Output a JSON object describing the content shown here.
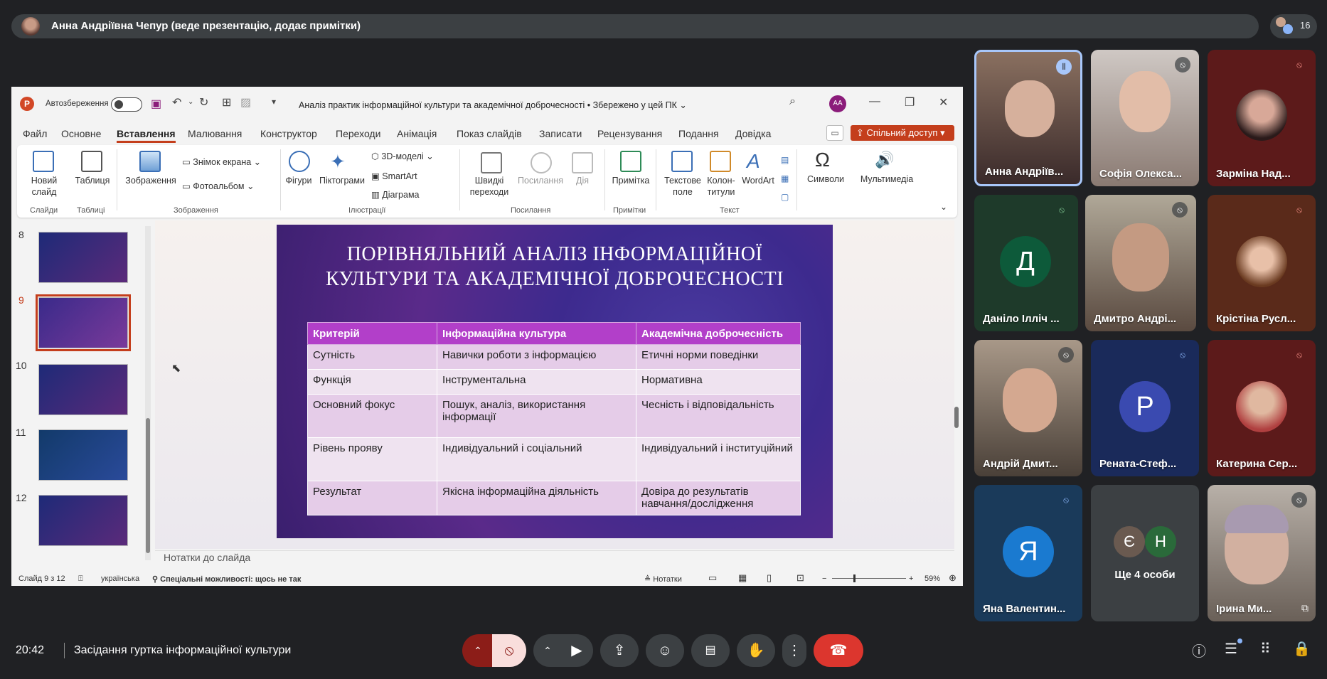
{
  "presenter_bar": {
    "text": "Анна Андріївна Чепур (веде презентацію, додає примітки)",
    "participant_count": "16"
  },
  "ppt": {
    "autosave": "Автозбереження",
    "doc_title": "Аналіз практик інформаційної культури та академічної доброчесності • Збережено у цей ПК",
    "user_initials": "AA",
    "tabs": [
      "Файл",
      "Основне",
      "Вставлення",
      "Малювання",
      "Конструктор",
      "Переходи",
      "Анімація",
      "Показ слайдів",
      "Записати",
      "Рецензування",
      "Подання",
      "Довідка"
    ],
    "share": "Спільний доступ",
    "ribbon": {
      "new_slide": "Новий\nслайд",
      "table": "Таблиця",
      "images": "Зображення",
      "screenshot": "Знімок екрана",
      "photo_album": "Фотоальбом",
      "shapes": "Фігури",
      "icons": "Піктограми",
      "models3d": "3D-моделі",
      "smartart": "SmartArt",
      "chart": "Діаграма",
      "quick_links": "Швидкі\nпереходи",
      "link": "Посилання",
      "action": "Дія",
      "comment": "Примітка",
      "textbox": "Текстове\nполе",
      "header_footer": "Колон-\nтитули",
      "wordart": "WordArt",
      "symbols": "Символи",
      "media": "Мультимедіа",
      "groups": {
        "slides": "Слайди",
        "tables": "Таблиці",
        "images": "Зображення",
        "illustrations": "Ілюстрації",
        "links": "Посилання",
        "comments": "Примітки",
        "text": "Текст"
      }
    },
    "thumb_numbers": [
      "8",
      "9",
      "10",
      "11",
      "12"
    ],
    "slide": {
      "title": "ПОРІВНЯЛЬНИЙ АНАЛІЗ ІНФОРМАЦІЙНОЇ КУЛЬТУРИ ТА АКАДЕМІЧНОЇ ДОБРОЧЕСНОСТІ",
      "headers": [
        "Критерій",
        "Інформаційна культура",
        "Академічна доброчесність"
      ],
      "rows": [
        [
          "Сутність",
          "Навички роботи з інформацією",
          "Етичні норми поведінки"
        ],
        [
          "Функція",
          "Інструментальна",
          "Нормативна"
        ],
        [
          "Основний фокус",
          "Пошук, аналіз, використання інформації",
          "Чесність і відповідальність"
        ],
        [
          "Рівень прояву",
          "Індивідуальний і соціальний",
          "Індивідуальний і інституційний"
        ],
        [
          "Результат",
          "Якісна інформаційна діяльність",
          "Довіра до результатів навчання/дослідження"
        ]
      ]
    },
    "notes_placeholder": "Нотатки до слайда",
    "status": {
      "slide": "Слайд 9 з 12",
      "lang": "українська",
      "accessibility": "Спеціальні можливості: щось не так",
      "notes": "Нотатки",
      "zoom": "59%"
    }
  },
  "tiles": [
    {
      "name": "Анна Андріїв...",
      "initial": ""
    },
    {
      "name": "Софія Олекса...",
      "initial": ""
    },
    {
      "name": "Зарміна Над...",
      "initial": ""
    },
    {
      "name": "Даніло Ілліч ...",
      "initial": "Д"
    },
    {
      "name": "Дмитро Андрі...",
      "initial": ""
    },
    {
      "name": "Крістіна Русл...",
      "initial": ""
    },
    {
      "name": "Андрій Дмит...",
      "initial": ""
    },
    {
      "name": "Рената-Стеф...",
      "initial": "Р"
    },
    {
      "name": "Катерина Сер...",
      "initial": ""
    },
    {
      "name": "Яна Валентин...",
      "initial": "Я"
    },
    {
      "name": "Ще 4 особи",
      "initial1": "Є",
      "initial2": "Н"
    },
    {
      "name": "Ірина Ми...",
      "initial": ""
    }
  ],
  "meeting": {
    "time": "20:42",
    "name": "Засідання гуртка інформаційної культури"
  }
}
